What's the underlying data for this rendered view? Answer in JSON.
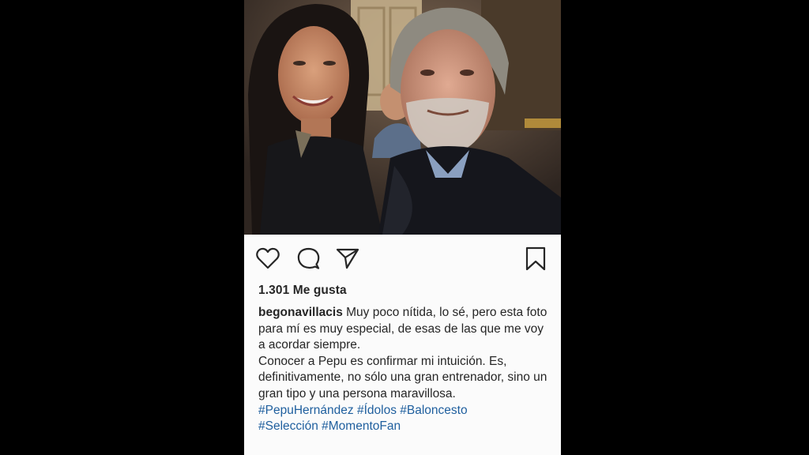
{
  "post": {
    "likes_text": "1.301 Me gusta",
    "username": "begonavillacis",
    "caption_p1": "Muy poco nítida, lo sé, pero esta foto para mí es muy especial, de esas de las que me voy a acordar siempre.",
    "caption_p2": "Conocer a Pepu es confirmar mi intuición. Es, definitivamente, no sólo una gran entrenador, sino un gran tipo y una persona maravillosa.",
    "hashtags": [
      "#PepuHernández",
      "#Ídolos",
      "#Baloncesto",
      "#Selección",
      "#MomentoFan"
    ]
  },
  "icons": {
    "like": "heart-icon",
    "comment": "comment-bubble-icon",
    "share": "paper-plane-icon",
    "save": "bookmark-icon"
  },
  "colors": {
    "background": "#000000",
    "card": "#fbfbfb",
    "text": "#262626",
    "hashtag": "#1f5f9e"
  }
}
